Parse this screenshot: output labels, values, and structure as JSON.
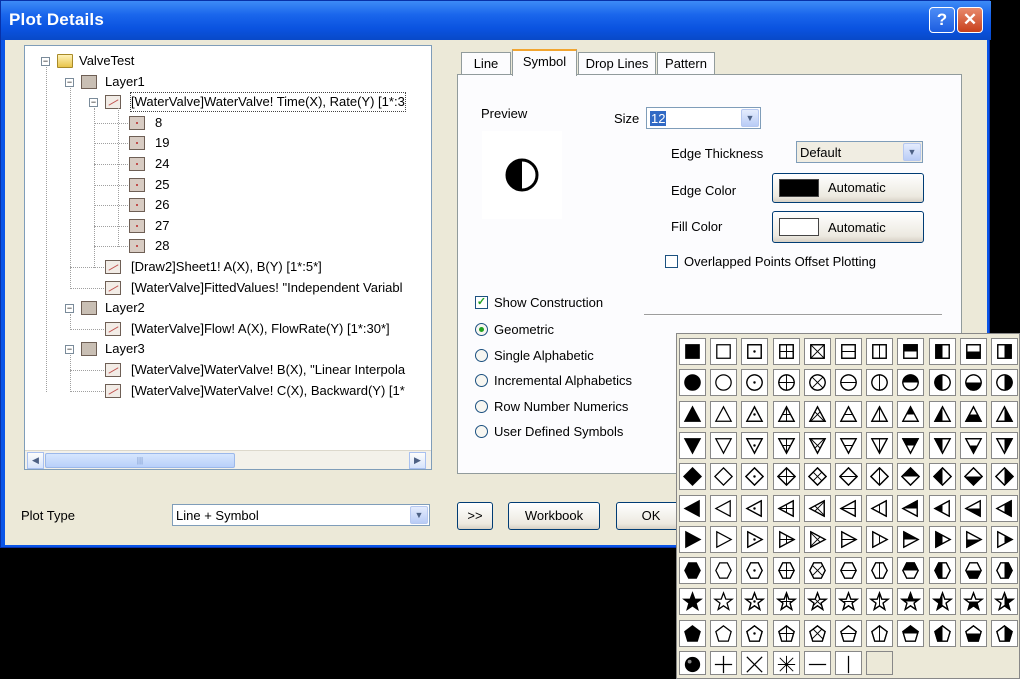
{
  "window": {
    "title": "Plot Details",
    "help_glyph": "?",
    "close_glyph": "✕"
  },
  "tree": {
    "nodes": [
      {
        "label": "ValveTest",
        "icon": "folder-icon",
        "level": 0,
        "expanded": true
      },
      {
        "label": "Layer1",
        "icon": "layer-icon",
        "level": 1,
        "expanded": true
      },
      {
        "label": "[WaterValve]WaterValve! Time(X), Rate(Y) [1*:3",
        "icon": "plot-icon",
        "level": 2,
        "expanded": true,
        "selected": true
      },
      {
        "label": "8",
        "icon": "point-icon",
        "level": 3
      },
      {
        "label": "19",
        "icon": "point-icon",
        "level": 3
      },
      {
        "label": "24",
        "icon": "point-icon",
        "level": 3
      },
      {
        "label": "25",
        "icon": "point-icon",
        "level": 3
      },
      {
        "label": "26",
        "icon": "point-icon",
        "level": 3
      },
      {
        "label": "27",
        "icon": "point-icon",
        "level": 3
      },
      {
        "label": "28",
        "icon": "point-icon",
        "level": 3
      },
      {
        "label": "[Draw2]Sheet1! A(X), B(Y) [1*:5*]",
        "icon": "plot-icon",
        "level": 2
      },
      {
        "label": "[WaterValve]FittedValues! \"Independent Variabl",
        "icon": "plot-icon",
        "level": 2
      },
      {
        "label": "Layer2",
        "icon": "layer-icon",
        "level": 1,
        "expanded": true
      },
      {
        "label": "[WaterValve]Flow! A(X), FlowRate(Y) [1*:30*]",
        "icon": "plot-icon",
        "level": 2
      },
      {
        "label": "Layer3",
        "icon": "layer-icon",
        "level": 1,
        "expanded": true
      },
      {
        "label": "[WaterValve]WaterValve! B(X), \"Linear Interpola",
        "icon": "plot-icon",
        "level": 2
      },
      {
        "label": "[WaterValve]WaterValve! C(X), Backward(Y) [1*",
        "icon": "plot-icon",
        "level": 2
      }
    ],
    "expander_glyph": "−"
  },
  "tabs": [
    {
      "label": "Line",
      "active": false
    },
    {
      "label": "Symbol",
      "active": true
    },
    {
      "label": "Drop Lines",
      "active": false
    },
    {
      "label": "Pattern",
      "active": false
    }
  ],
  "symbol": {
    "preview_label": "Preview",
    "size_label": "Size",
    "size_value": "12",
    "edge_thickness_label": "Edge Thickness",
    "edge_thickness_value": "Default",
    "edge_color_label": "Edge Color",
    "edge_color_button": "Automatic",
    "edge_color": "#000000",
    "fill_color_label": "Fill Color",
    "fill_color_button": "Automatic",
    "fill_color": "#ffffff",
    "overlapped_label": "Overlapped Points Offset Plotting",
    "show_construction_label": "Show Construction",
    "radio_options": [
      {
        "label": "Geometric",
        "selected": true
      },
      {
        "label": "Single Alphabetic",
        "selected": false
      },
      {
        "label": "Incremental Alphabetics",
        "selected": false
      },
      {
        "label": "Row Number Numerics",
        "selected": false
      },
      {
        "label": "User Defined Symbols",
        "selected": false
      }
    ]
  },
  "bottom": {
    "plot_type_label": "Plot Type",
    "plot_type_value": "Line + Symbol",
    "more_button": ">>",
    "workbook_button": "Workbook",
    "ok_button": "OK"
  },
  "palette": {
    "rows": [
      "square",
      "circle",
      "up-triangle",
      "down-triangle",
      "diamond",
      "left-triangle",
      "right-triangle",
      "hexagon",
      "star",
      "pentagon"
    ],
    "columns": [
      "filled",
      "hollow",
      "dot-center",
      "plus-cross",
      "x-cross",
      "horizontal-bar",
      "vertical-bar",
      "top-half",
      "left-half",
      "bottom-half",
      "right-half"
    ],
    "last_row": [
      "sphere",
      "plus",
      "cross",
      "asterisk",
      "horizontal-line",
      "vertical-line",
      "empty"
    ]
  }
}
